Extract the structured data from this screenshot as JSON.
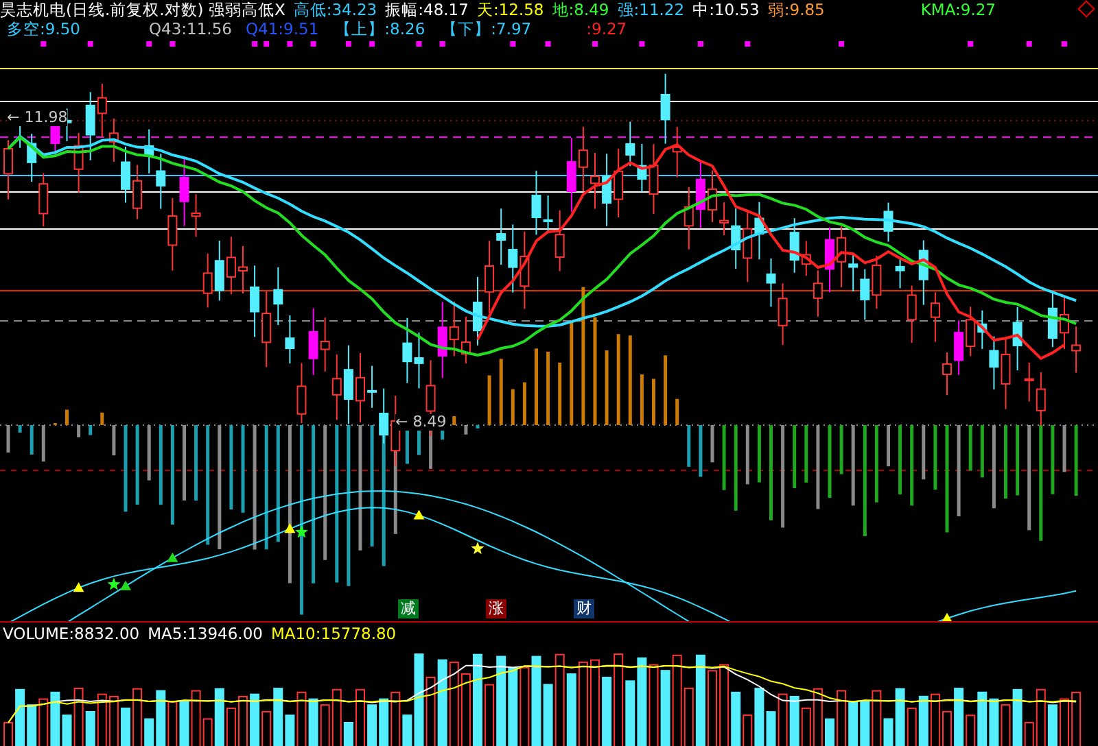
{
  "header": {
    "title": "昊志机电(日线.前复权.对数) 强弱高低X",
    "line1": [
      {
        "label": "高低:",
        "value": "34.23",
        "color": "#33ccff"
      },
      {
        "label": "振幅:",
        "value": "48.17",
        "color": "#ffffff"
      },
      {
        "label": "天:",
        "value": "12.58",
        "color": "#ffff00"
      },
      {
        "label": "地:",
        "value": "8.49",
        "color": "#33ff33"
      },
      {
        "label": "强:",
        "value": "11.22",
        "color": "#33ccff"
      },
      {
        "label": "中:",
        "value": "10.53",
        "color": "#ffffff"
      },
      {
        "label": "弱:",
        "value": "9.85",
        "color": "#ff9933"
      }
    ],
    "kma": {
      "label": "KMA:",
      "value": "9.27"
    },
    "line2": [
      {
        "label": "多空:",
        "value": "9.50",
        "color": "#33ccff"
      },
      {
        "label": "Q43:",
        "value": "11.56",
        "color": "#c0c0c0"
      },
      {
        "label": "Q41:",
        "value": "9.51",
        "color": "#2255ff"
      },
      {
        "label": "【上】",
        "value": ":8.26",
        "color": "#33ccff"
      },
      {
        "label": "【下】",
        "value": ":7.97",
        "color": "#33ccff"
      },
      {
        "value": ":9.27",
        "color": "#ff2222"
      }
    ]
  },
  "price_marks": [
    {
      "text": "← 11.98",
      "kind": "high"
    },
    {
      "text": "← 8.49",
      "kind": "low"
    }
  ],
  "signals": [
    {
      "label": "减",
      "color": "#007a1f"
    },
    {
      "label": "涨",
      "color": "#8a0000"
    },
    {
      "label": "财",
      "color": "#12366b"
    }
  ],
  "volume": [
    {
      "label": "VOLUME:",
      "value": "8832.00",
      "color": "#ffffff"
    },
    {
      "label": "MA5:",
      "value": "13946.00",
      "color": "#ffffff"
    },
    {
      "label": "MA10:",
      "value": "15778.80",
      "color": "#ffff00"
    }
  ]
}
